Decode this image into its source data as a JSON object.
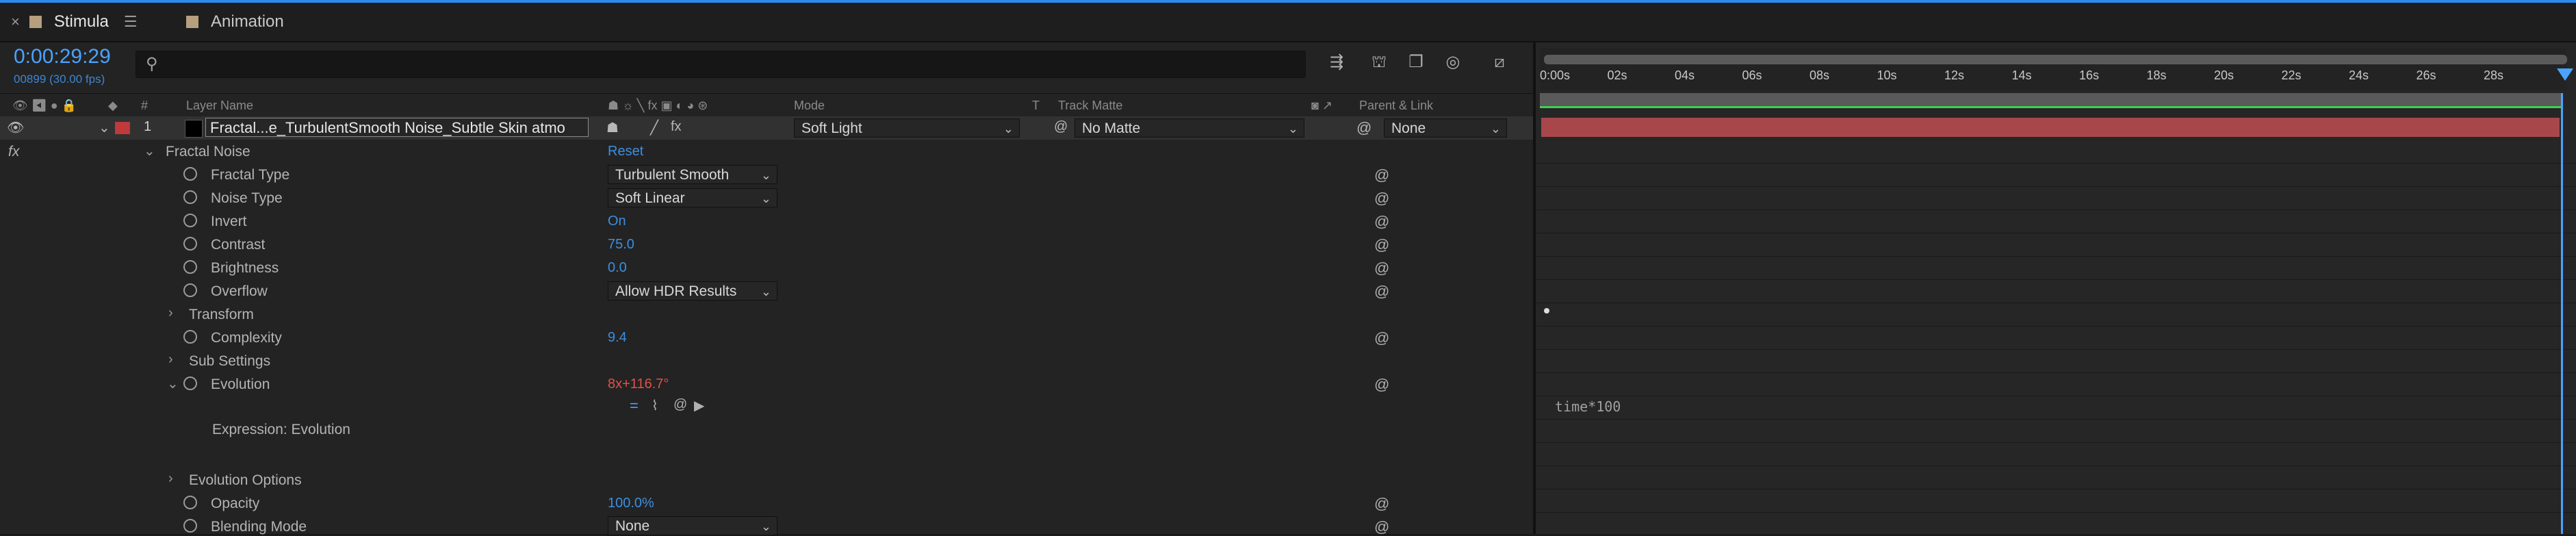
{
  "tabs": [
    {
      "label": "Stimula",
      "active": true
    },
    {
      "label": "Animation",
      "active": false
    }
  ],
  "header": {
    "timecode": "0:00:29:29",
    "frames": "00899 (30.00 fps)",
    "search_placeholder": ""
  },
  "columns": {
    "num": "#",
    "layer_name": "Layer Name",
    "mode": "Mode",
    "t": "T",
    "track_matte": "Track Matte",
    "parent_link": "Parent & Link"
  },
  "layer": {
    "number": "1",
    "name": "Fractal...e_TurbulentSmooth Noise_Subtle Skin atmo",
    "mode": "Soft Light",
    "track_matte": "No Matte",
    "parent": "None",
    "label_color": "#c0393b"
  },
  "fx_label": "fx",
  "properties": {
    "fractal_noise": "Fractal Noise",
    "reset": "Reset",
    "fractal_type": {
      "label": "Fractal Type",
      "value": "Turbulent Smooth"
    },
    "noise_type": {
      "label": "Noise Type",
      "value": "Soft Linear"
    },
    "invert": {
      "label": "Invert",
      "value": "On"
    },
    "contrast": {
      "label": "Contrast",
      "value": "75.0"
    },
    "brightness": {
      "label": "Brightness",
      "value": "0.0"
    },
    "overflow": {
      "label": "Overflow",
      "value": "Allow HDR Results"
    },
    "transform": "Transform",
    "complexity": {
      "label": "Complexity",
      "value": "9.4"
    },
    "sub_settings": "Sub Settings",
    "evolution": {
      "label": "Evolution",
      "value_rev": "8x",
      "value_deg": "+116.7°"
    },
    "expression_label": "Expression: Evolution",
    "expression_text": "time*100",
    "evolution_options": "Evolution Options",
    "opacity": {
      "label": "Opacity",
      "value": "100.0%"
    },
    "blending_mode": {
      "label": "Blending Mode",
      "value": "None"
    }
  },
  "timeline": {
    "ticks": [
      "0:00s",
      "02s",
      "04s",
      "06s",
      "08s",
      "10s",
      "12s",
      "14s",
      "16s",
      "18s",
      "20s",
      "22s",
      "24s",
      "26s",
      "28s"
    ]
  },
  "colors": {
    "accent": "#2d8ceb",
    "layer_bar": "#a8474b",
    "value_blue": "#3b8fe0",
    "evolution_red": "#e0504a"
  }
}
